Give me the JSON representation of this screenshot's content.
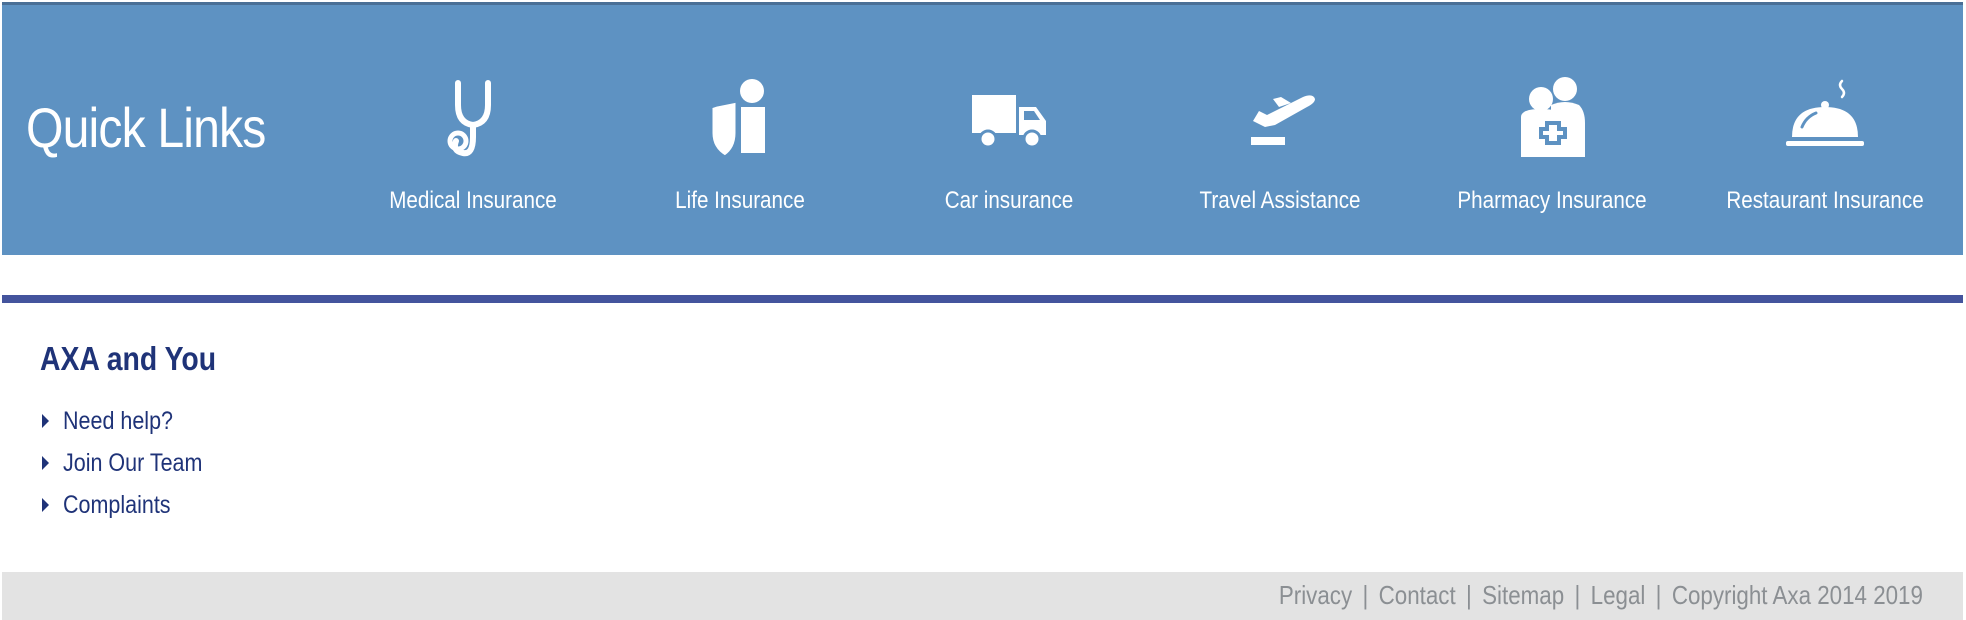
{
  "quick_links": {
    "title": "Quick Links",
    "items": [
      {
        "label": "Medical Insurance",
        "icon": "stethoscope-icon"
      },
      {
        "label": "Life Insurance",
        "icon": "shield-person-icon"
      },
      {
        "label": "Car insurance",
        "icon": "truck-icon"
      },
      {
        "label": "Travel Assistance",
        "icon": "plane-departure-icon"
      },
      {
        "label": "Pharmacy Insurance",
        "icon": "medical-cross-person-icon"
      },
      {
        "label": "Restaurant Insurance",
        "icon": "cloche-icon"
      }
    ]
  },
  "axa_you": {
    "heading": "AXA and You",
    "links": [
      "Need help?",
      "Join Our Team",
      "Complaints"
    ]
  },
  "footer": {
    "links": [
      "Privacy",
      "Contact",
      "Sitemap",
      "Legal"
    ],
    "separator": "|",
    "copyright": "Copyright Axa 2014 2019"
  },
  "colors": {
    "banner": "#5e92c2",
    "divider": "#44549d",
    "navy_text": "#1f3378",
    "footer_bg": "#e3e3e3",
    "footer_text": "#8b8f93"
  }
}
